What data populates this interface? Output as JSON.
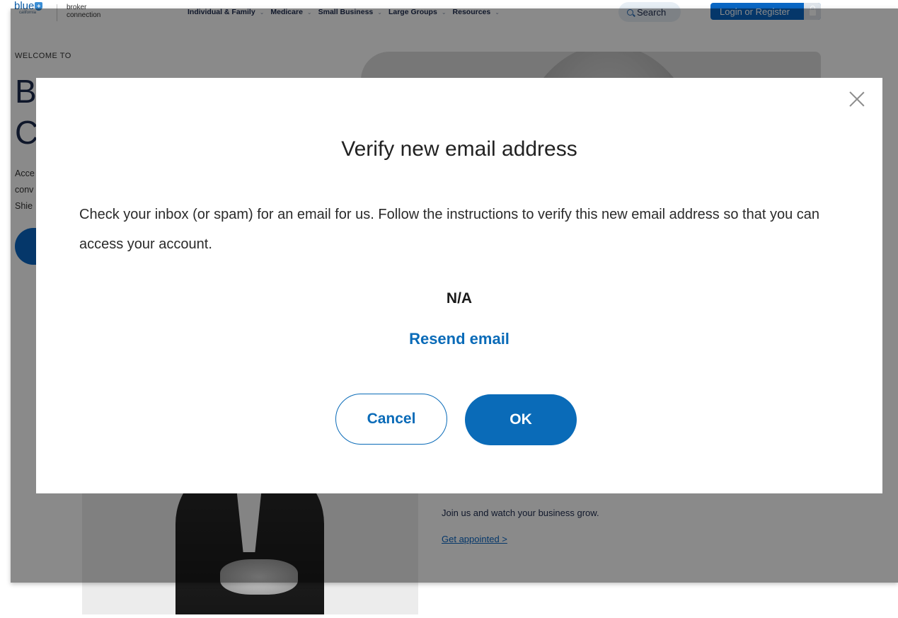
{
  "header": {
    "logo": {
      "brand": "blue",
      "region": "california",
      "product_line1": "broker",
      "product_line2": "connection"
    },
    "nav": [
      {
        "label": "Individual & Family"
      },
      {
        "label": "Medicare"
      },
      {
        "label": "Small Business"
      },
      {
        "label": "Large Groups"
      },
      {
        "label": "Resources"
      }
    ],
    "search_label": "Search",
    "login_label": "Login or Register"
  },
  "background": {
    "welcome": "WELCOME TO",
    "hero_title_line1": "B",
    "hero_title_line2": "C",
    "hero_text_line1": "Acce",
    "hero_text_line2": "conv",
    "hero_text_line3": "Shie",
    "join_text": "Join us and watch your business grow.",
    "appoint_link": "Get appointed >"
  },
  "modal": {
    "title": "Verify new email address",
    "body": "Check your inbox (or spam) for an email for us. Follow the instructions to verify this new email address so that you can access your account.",
    "email": "N/A",
    "resend_label": "Resend email",
    "cancel_label": "Cancel",
    "ok_label": "OK"
  },
  "colors": {
    "primary": "#0a6bb8",
    "overlay": "rgba(0,0,0,0.46)",
    "nav_text": "#1d2b4f"
  }
}
